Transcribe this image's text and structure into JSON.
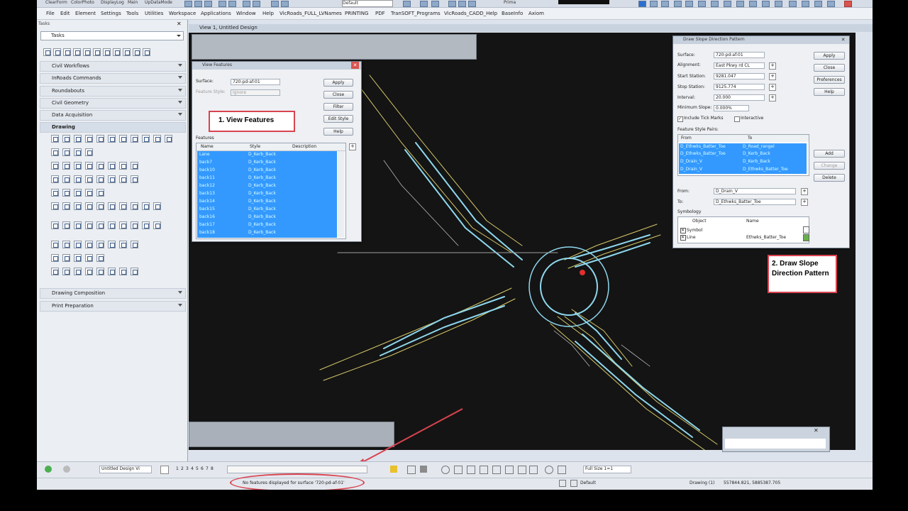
{
  "ribbon": {
    "items": [
      "ClearForm",
      "ColorPhoto",
      "DisplayLog",
      "Main",
      "UpDataMode",
      "Default",
      "Prima"
    ]
  },
  "menu": [
    "File",
    "Edit",
    "Element",
    "Settings",
    "Tools",
    "Utilities",
    "Workspace",
    "Applications",
    "Window",
    "Help",
    "VicRoads_FULL_LVNames",
    "PRINTING",
    "PDF",
    "TranSOFT_Programs",
    "VicRoads_CADD_Help",
    "BaseInfo",
    "Axiom"
  ],
  "tasks": {
    "header": "Tasks",
    "dropdown": "Tasks",
    "sections": [
      "Civil Workflows",
      "InRoads Commands",
      "Roundabouts",
      "Civil Geometry",
      "Data Acquisition",
      "Drawing",
      "Drawing Composition",
      "Print Preparation"
    ]
  },
  "view": {
    "title": "View 1, Untitled Design"
  },
  "view_features": {
    "title": "View Features",
    "surface_label": "Surface:",
    "surface_value": "720-pd-af-01",
    "feature_label": "Feature Style:",
    "feature_value": "Ignore",
    "features_label": "Features",
    "buttons": [
      "Apply",
      "Close",
      "Filter",
      "Edit Style",
      "Help"
    ],
    "columns": [
      "Name",
      "Style",
      "Description"
    ],
    "rows": [
      {
        "name": "Lane",
        "style": "D_Kerb_Back"
      },
      {
        "name": "back7",
        "style": "D_Kerb_Back"
      },
      {
        "name": "back10",
        "style": "D_Kerb_Back"
      },
      {
        "name": "back11",
        "style": "D_Kerb_Back"
      },
      {
        "name": "back12",
        "style": "D_Kerb_Back"
      },
      {
        "name": "back13",
        "style": "D_Kerb_Back"
      },
      {
        "name": "back14",
        "style": "D_Kerb_Back"
      },
      {
        "name": "back15",
        "style": "D_Kerb_Back"
      },
      {
        "name": "back16",
        "style": "D_Kerb_Back"
      },
      {
        "name": "back17",
        "style": "D_Kerb_Back"
      },
      {
        "name": "back18",
        "style": "D_Kerb_Back"
      }
    ]
  },
  "callout1": "1. View Features",
  "callout2": "2. Draw Slope Direction Pattern",
  "slope_dialog": {
    "title": "Draw Slope Direction Pattern",
    "surface_label": "Surface:",
    "surface_value": "720-pd-af-01",
    "alignment_label": "Alignment:",
    "alignment_value": "East Pkwy rd CL",
    "start_label": "Start Station:",
    "start_value": "9281.047",
    "stop_label": "Stop Station:",
    "stop_value": "9125.774",
    "interval_label": "Interval:",
    "interval_value": "20.000",
    "min_slope_label": "Minimum Slope:",
    "min_slope_value": "0.000%",
    "tick_label": "Include Tick Marks",
    "interactive_label": "Interactive",
    "pairs_label": "Feature Style Pairs:",
    "pairs_cols": [
      "From",
      "To"
    ],
    "pairs": [
      {
        "from": "D_Ethwks_Batter_Toe",
        "to": "D_Road_rangel"
      },
      {
        "from": "D_Ethwks_Batter_Toe",
        "to": "D_Kerb_Back"
      },
      {
        "from": "D_Drain_V",
        "to": "D_Kerb_Back"
      },
      {
        "from": "D_Drain_V",
        "to": "D_Ethwks_Batter_Toe"
      }
    ],
    "from_label": "From:",
    "from_value": "D_Drain_V",
    "to_label": "To:",
    "to_value": "D_Ethwks_Batter_Toe",
    "symbology_label": "Symbology",
    "sym_cols": [
      "Object",
      "Name"
    ],
    "sym_rows": [
      {
        "object": "Symbol",
        "name": ""
      },
      {
        "object": "Line",
        "name": "Ethwks_Batter_Toe"
      }
    ],
    "buttons": [
      "Apply",
      "Close",
      "Preferences",
      "Help"
    ],
    "list_buttons": [
      "Add",
      "Change",
      "Delete"
    ]
  },
  "status": {
    "message": "No features displayed for surface '720-pd-af-01'",
    "model": "Untitled Design Vi",
    "views": [
      "1",
      "2",
      "3",
      "4",
      "5",
      "6",
      "7",
      "8"
    ],
    "scale": "Full Size 1=1",
    "level": "Default",
    "drawing": "Drawing (1)",
    "coords": "557844.821, 5885387.705"
  },
  "colors": {
    "callout_border": "#d9434f",
    "selection": "#3399ff",
    "canvas": "#141414",
    "road_cyan": "#8ed8ee",
    "edge_yellow": "#d6c86a"
  }
}
